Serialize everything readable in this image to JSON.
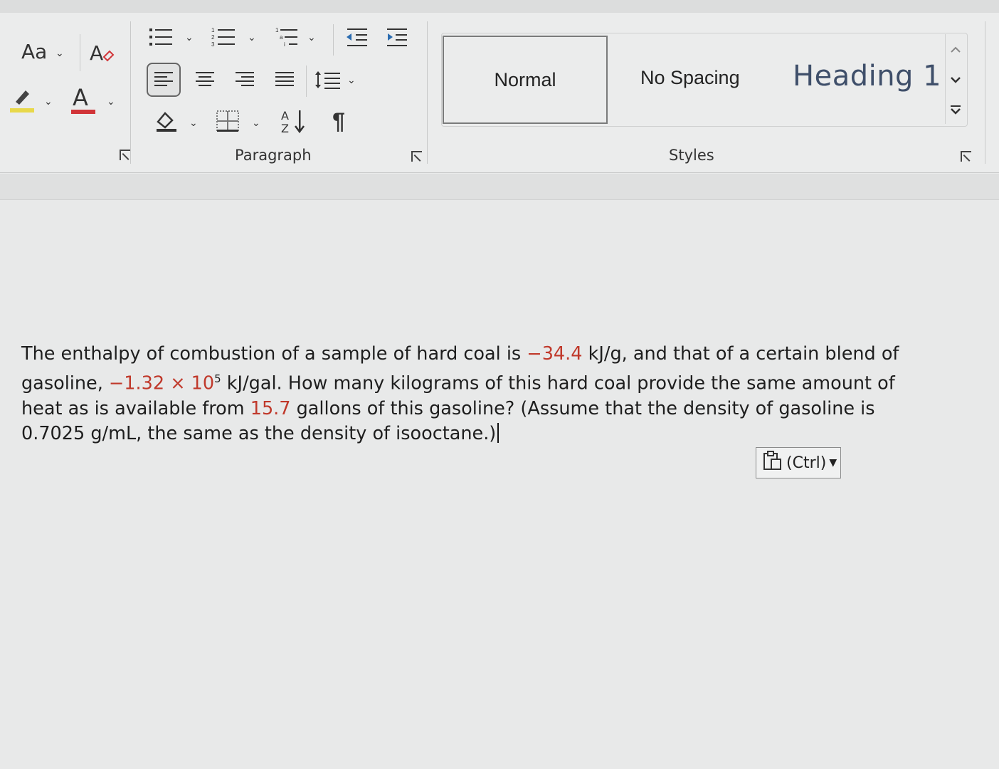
{
  "ribbon": {
    "font_group": {
      "change_case_label": "Aa",
      "font_color_label": "A"
    },
    "paragraph_group": {
      "label": "Paragraph",
      "sort_label": "A Z",
      "pilcrow": "¶"
    },
    "styles_group": {
      "label": "Styles",
      "items": [
        "Normal",
        "No Spacing",
        "Heading 1"
      ]
    },
    "colors": {
      "font_color": "#d13438",
      "highlight_color": "#e8d84a",
      "heading_color": "#3f4f6a"
    }
  },
  "document": {
    "parts": [
      "The enthalpy of combustion of a sample of hard coal is ",
      "−34.4",
      " kJ/g, and that of a certain blend of gasoline, ",
      "−1.32",
      " × 10",
      "5",
      " kJ/gal. How many kilograms of this hard coal provide the same amount of heat as is available from ",
      "15.7",
      " gallons of this gasoline? (Assume that the density of gasoline is 0.7025 g/mL, the same as the density of isooctane.)"
    ],
    "highlight_color": "#c0392b"
  },
  "paste_options": {
    "label": "(Ctrl)"
  }
}
